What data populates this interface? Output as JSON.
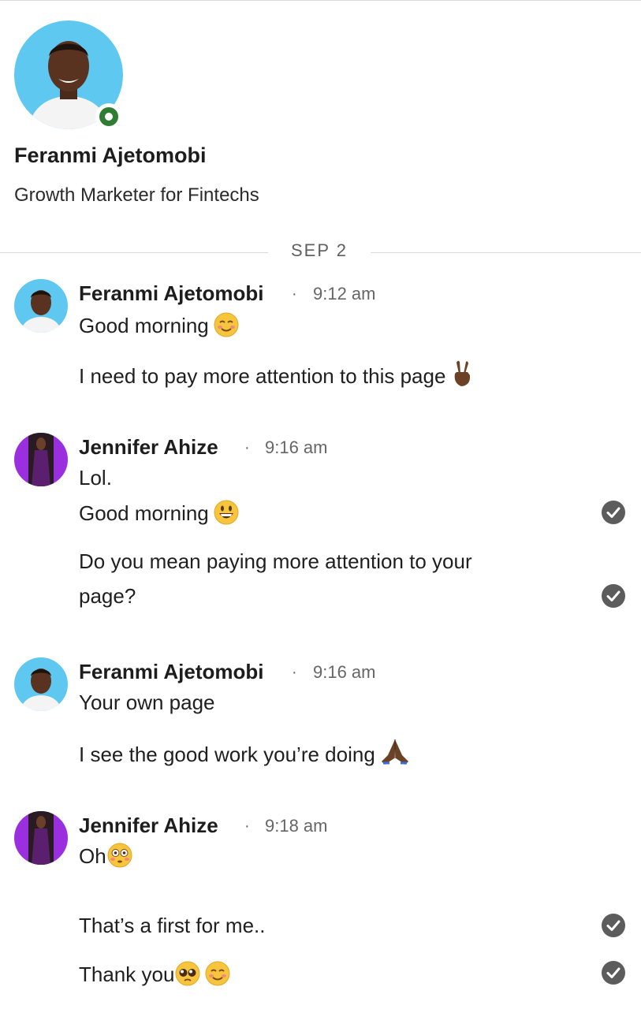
{
  "profile": {
    "name": "Feranmi Ajetomobi",
    "headline": "Growth Marketer for Fintechs"
  },
  "date_divider": "SEP 2",
  "messages": [
    {
      "sender": "Feranmi Ajetomobi",
      "separator": "·",
      "time": "9:12 am",
      "lines": [
        "Good morning",
        "I need to pay more attention to this page"
      ]
    },
    {
      "sender": "Jennifer Ahize",
      "separator": "·",
      "time": "9:16 am",
      "lines": [
        "Lol.",
        "Good morning",
        "Do you mean paying more attention to your",
        "page?"
      ]
    },
    {
      "sender": "Feranmi Ajetomobi",
      "separator": "·",
      "time": "9:16 am",
      "lines": [
        "Your own page",
        "I see the good work you’re doing"
      ]
    },
    {
      "sender": "Jennifer Ahize",
      "separator": "·",
      "time": "9:18 am",
      "lines": [
        "Oh",
        "That’s a first for me..",
        "Thank you"
      ]
    }
  ],
  "icons": {
    "smiling-blush": "smiling-face-icon",
    "victory": "victory-hand-icon",
    "grin": "grinning-face-icon",
    "prayer": "folded-hands-icon",
    "flushed": "flushed-face-icon",
    "pleading": "pleading-face-icon",
    "read": "read-receipt-check-icon"
  },
  "colors": {
    "online": "#2e7d32",
    "avatar_blue": "#5ec8f0",
    "avatar_purple": "#9a2fe0",
    "check": "#5c5c5c"
  }
}
